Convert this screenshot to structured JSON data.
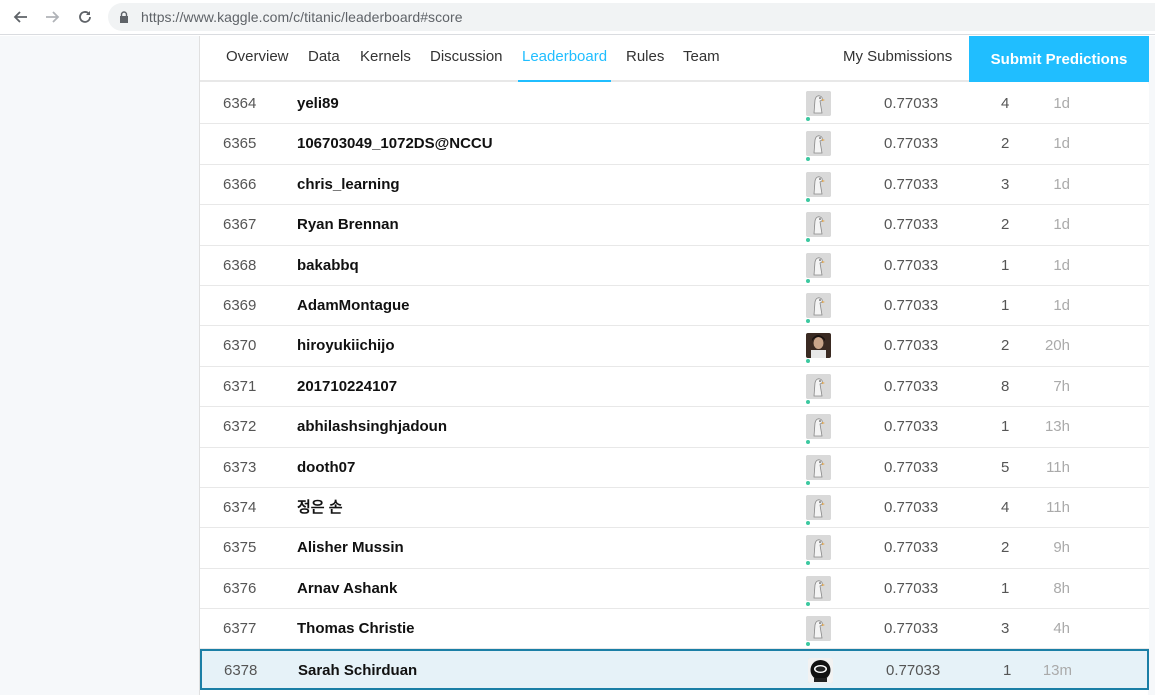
{
  "browser": {
    "url": "https://www.kaggle.com/c/titanic/leaderboard#score"
  },
  "tabs": [
    {
      "label": "Overview",
      "active": false
    },
    {
      "label": "Data",
      "active": false
    },
    {
      "label": "Kernels",
      "active": false
    },
    {
      "label": "Discussion",
      "active": false
    },
    {
      "label": "Leaderboard",
      "active": true
    },
    {
      "label": "Rules",
      "active": false
    },
    {
      "label": "Team",
      "active": false
    }
  ],
  "header": {
    "my_submissions": "My Submissions",
    "submit_predictions": "Submit Predictions"
  },
  "colors": {
    "accent": "#20beff",
    "highlight_bg": "#e6f2f8",
    "highlight_border": "#1b7fa6",
    "tier_dot": "#3cc8a0"
  },
  "leaderboard": [
    {
      "rank": "6364",
      "name": "yeli89",
      "avatar": "goose-avatar",
      "score": "0.77033",
      "entries": "4",
      "last": "1d"
    },
    {
      "rank": "6365",
      "name": "106703049_1072DS@NCCU",
      "avatar": "goose-avatar",
      "score": "0.77033",
      "entries": "2",
      "last": "1d"
    },
    {
      "rank": "6366",
      "name": "chris_learning",
      "avatar": "goose-avatar",
      "score": "0.77033",
      "entries": "3",
      "last": "1d"
    },
    {
      "rank": "6367",
      "name": "Ryan Brennan",
      "avatar": "goose-avatar",
      "score": "0.77033",
      "entries": "2",
      "last": "1d"
    },
    {
      "rank": "6368",
      "name": "bakabbq",
      "avatar": "goose-avatar",
      "score": "0.77033",
      "entries": "1",
      "last": "1d"
    },
    {
      "rank": "6369",
      "name": "AdamMontague",
      "avatar": "goose-avatar",
      "score": "0.77033",
      "entries": "1",
      "last": "1d"
    },
    {
      "rank": "6370",
      "name": "hiroyukiichijo",
      "avatar": "photo-avatar",
      "score": "0.77033",
      "entries": "2",
      "last": "20h"
    },
    {
      "rank": "6371",
      "name": "201710224107",
      "avatar": "goose-avatar",
      "score": "0.77033",
      "entries": "8",
      "last": "7h"
    },
    {
      "rank": "6372",
      "name": "abhilashsinghjadoun",
      "avatar": "goose-avatar",
      "score": "0.77033",
      "entries": "1",
      "last": "13h"
    },
    {
      "rank": "6373",
      "name": "dooth07",
      "avatar": "goose-avatar",
      "score": "0.77033",
      "entries": "5",
      "last": "11h"
    },
    {
      "rank": "6374",
      "name": "정은 손",
      "avatar": "goose-avatar",
      "score": "0.77033",
      "entries": "4",
      "last": "11h"
    },
    {
      "rank": "6375",
      "name": "Alisher Mussin",
      "avatar": "goose-avatar",
      "score": "0.77033",
      "entries": "2",
      "last": "9h"
    },
    {
      "rank": "6376",
      "name": "Arnav Ashank",
      "avatar": "goose-avatar",
      "score": "0.77033",
      "entries": "1",
      "last": "8h"
    },
    {
      "rank": "6377",
      "name": "Thomas Christie",
      "avatar": "goose-avatar",
      "score": "0.77033",
      "entries": "3",
      "last": "4h"
    },
    {
      "rank": "6378",
      "name": "Sarah Schirduan",
      "avatar": "helmet-avatar",
      "score": "0.77033",
      "entries": "1",
      "last": "13m",
      "highlight": true
    }
  ]
}
